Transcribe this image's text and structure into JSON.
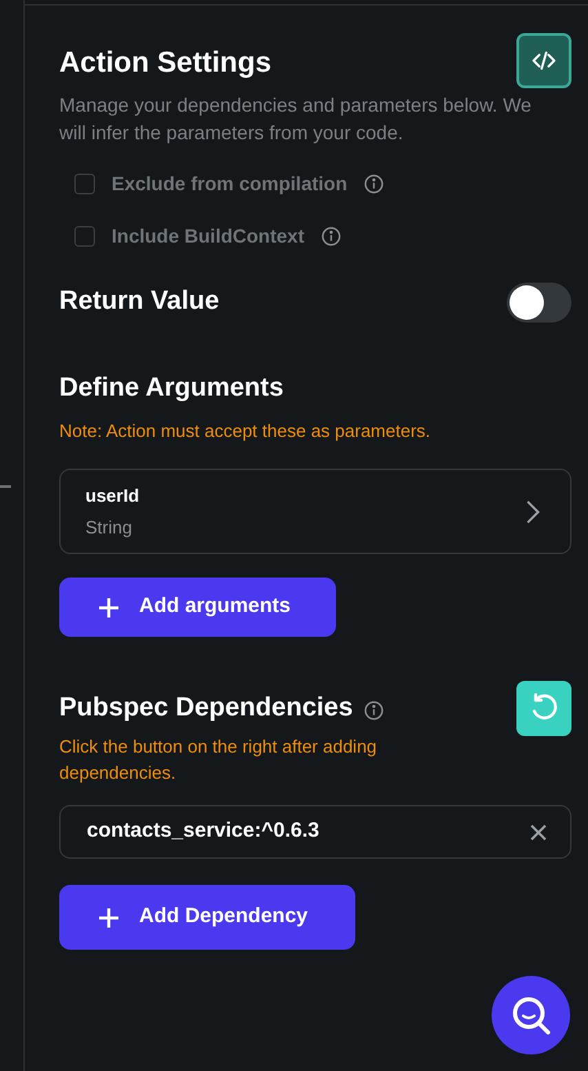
{
  "header": {
    "title": "Action Settings",
    "description": "Manage your dependencies and parameters below. We will infer the parameters from your code."
  },
  "options": [
    {
      "label": "Exclude from compilation",
      "checked": false,
      "disabled": true
    },
    {
      "label": "Include BuildContext",
      "checked": false,
      "disabled": true
    }
  ],
  "return_value": {
    "label": "Return Value",
    "on": false
  },
  "arguments": {
    "title": "Define Arguments",
    "note": "Note: Action must accept these as parameters.",
    "items": [
      {
        "name": "userId",
        "type": "String"
      }
    ],
    "add_button": "Add arguments"
  },
  "dependencies": {
    "title": "Pubspec Dependencies",
    "note": "Click the button on the right after adding dependencies.",
    "items": [
      "contacts_service:^0.6.3"
    ],
    "add_button": "Add Dependency"
  }
}
